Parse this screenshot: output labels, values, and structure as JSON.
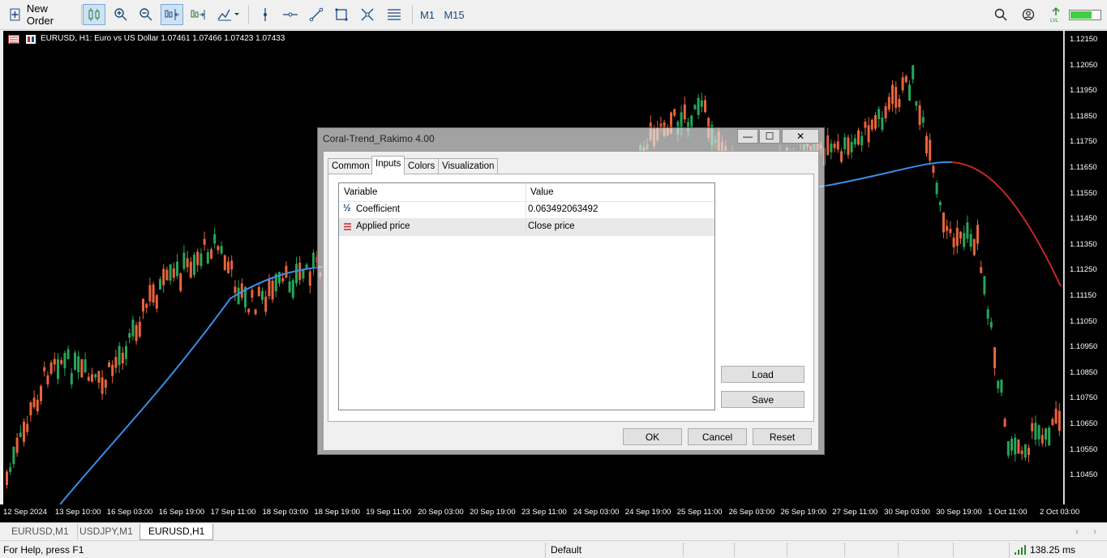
{
  "toolbar": {
    "new_order_label": "New Order",
    "tf_m1": "M1",
    "tf_m15": "M15",
    "icons": [
      "new-order-icon",
      "candlestick-icon",
      "zoom-in-icon",
      "zoom-out-icon",
      "chart-shift-icon",
      "autoscroll-icon",
      "indicators-icon",
      "vertical-line-icon",
      "horizontal-line-icon",
      "trendline-icon",
      "rectangle-icon",
      "fibonacci-icon",
      "text-tools-icon",
      "search-icon",
      "account-icon",
      "signal-icon",
      "battery-icon"
    ]
  },
  "chart": {
    "symbol_title": "EURUSD, H1:  Euro vs US Dollar  1.07461  1.07466  1.07423  1.07433",
    "colors": {
      "up": "#26a65b",
      "down": "#e8643c",
      "ma_up": "#3a8ee6",
      "ma_down": "#c62828",
      "background": "#000000"
    },
    "y_labels": [
      "1.12150",
      "1.12050",
      "1.11950",
      "1.11850",
      "1.11750",
      "1.11650",
      "1.11550",
      "1.11450",
      "1.11350",
      "1.11250",
      "1.11150",
      "1.11050",
      "1.10950",
      "1.10850",
      "1.10750",
      "1.10650",
      "1.10550",
      "1.10450"
    ],
    "x_labels": [
      "12 Sep 2024",
      "13 Sep 10:00",
      "16 Sep 03:00",
      "16 Sep 19:00",
      "17 Sep 11:00",
      "18 Sep 03:00",
      "18 Sep 19:00",
      "19 Sep 11:00",
      "20 Sep 03:00",
      "20 Sep 19:00",
      "23 Sep 11:00",
      "24 Sep 03:00",
      "24 Sep 19:00",
      "25 Sep 11:00",
      "26 Sep 03:00",
      "26 Sep 19:00",
      "27 Sep 11:00",
      "30 Sep 03:00",
      "30 Sep 19:00",
      "1 Oct 11:00",
      "2 Oct 03:00"
    ]
  },
  "chart_tabs": [
    "EURUSD,M1",
    "USDJPY,M1",
    "EURUSD,H1"
  ],
  "active_chart_tab": "EURUSD,H1",
  "status": {
    "help": "For Help, press F1",
    "profile": "Default",
    "ping": "138.25 ms"
  },
  "dialog": {
    "title": "Coral-Trend_Rakimo 4.00",
    "window_buttons": {
      "minimize": "—",
      "maximize": "☐",
      "close": "✕"
    },
    "tabs": [
      "Common",
      "Inputs",
      "Colors",
      "Visualization"
    ],
    "active_tab": "Inputs",
    "table": {
      "headers": [
        "Variable",
        "Value"
      ],
      "rows": [
        {
          "icon": "½",
          "variable": "Coefficient",
          "value": "0.063492063492"
        },
        {
          "icon": "list-icon",
          "variable": "Applied price",
          "value": "Close price"
        }
      ]
    },
    "buttons": {
      "load": "Load",
      "save": "Save",
      "ok": "OK",
      "cancel": "Cancel",
      "reset": "Reset"
    }
  }
}
